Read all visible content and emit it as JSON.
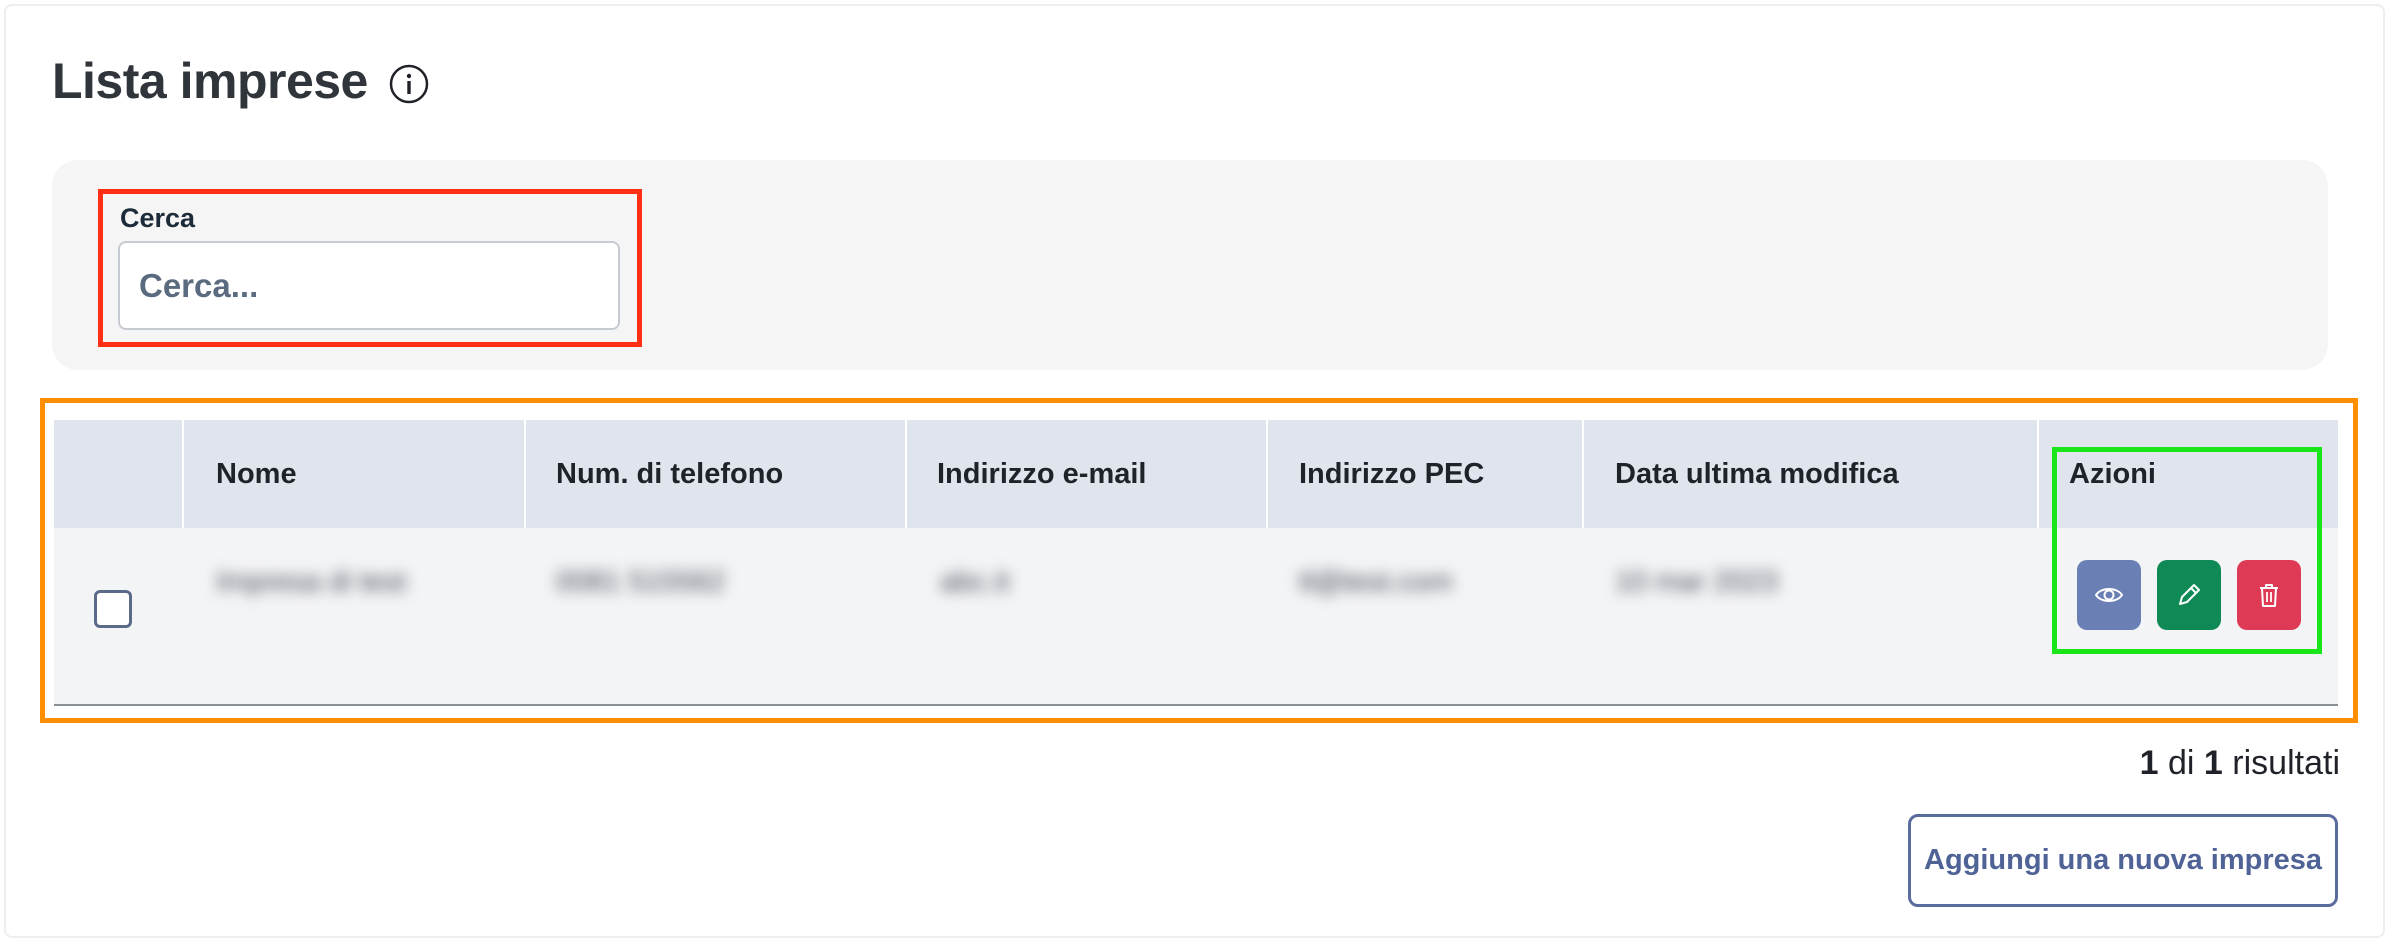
{
  "header": {
    "title": "Lista imprese",
    "info_icon": "info-circle-icon"
  },
  "search": {
    "label": "Cerca",
    "placeholder": "Cerca...",
    "value": ""
  },
  "table": {
    "columns": [
      "Nome",
      "Num. di telefono",
      "Indirizzo e-mail",
      "Indirizzo PEC",
      "Data ultima modifica",
      "Azioni"
    ],
    "rows": [
      {
        "checked": false,
        "nome": "Impresa di test",
        "telefono": "0081 515562",
        "email": "abc.it",
        "pec": "tl@test.com",
        "data_modifica": "10 mar 2023",
        "actions": [
          {
            "icon": "eye-icon",
            "color": "#6a7fb3"
          },
          {
            "icon": "pencil-icon",
            "color": "#0f8a57"
          },
          {
            "icon": "trash-icon",
            "color": "#de3a55"
          }
        ]
      }
    ]
  },
  "pagination": {
    "current": "1",
    "separator": "di",
    "total": "1",
    "suffix": "risultati"
  },
  "footer": {
    "add_button_label": "Aggiungi una nuova impresa"
  },
  "annotation_colors": {
    "search": "#ff2f14",
    "table": "#ff8f00",
    "actions": "#19e619"
  }
}
